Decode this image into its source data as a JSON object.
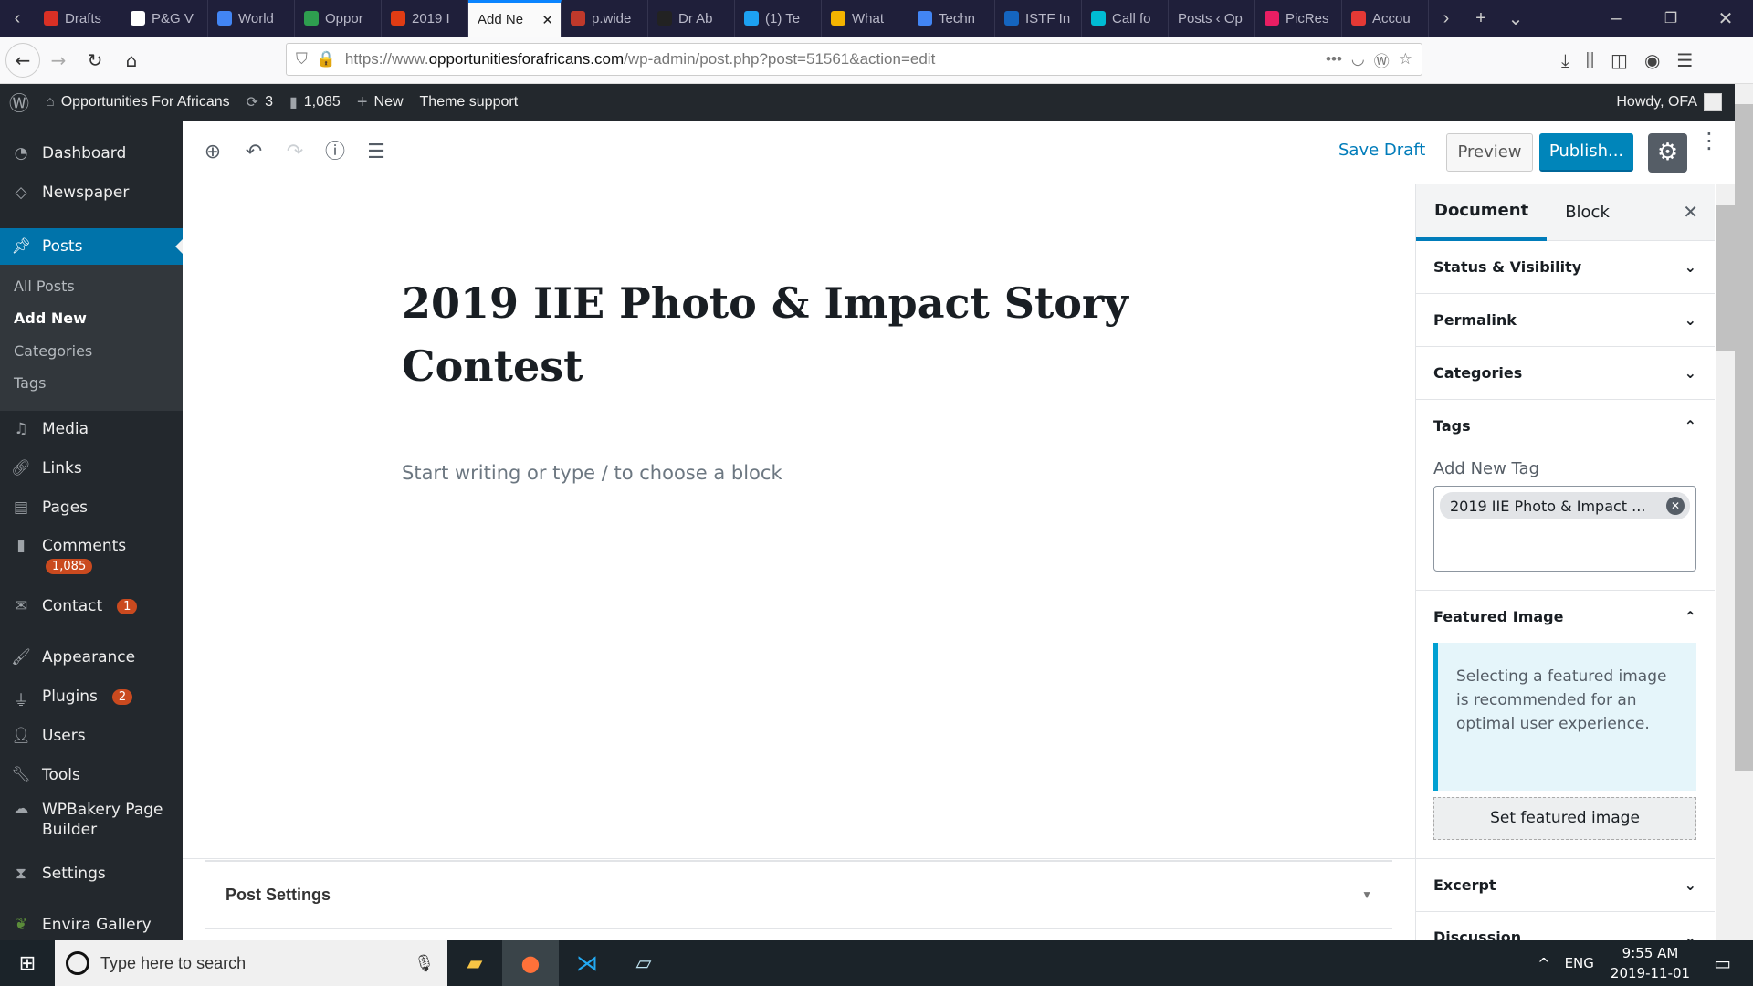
{
  "browser": {
    "tabs": [
      {
        "label": "Drafts",
        "color": "#d93025"
      },
      {
        "label": "P&G V",
        "color": "#ffffff"
      },
      {
        "label": "World",
        "color": "#4285f4"
      },
      {
        "label": "Oppor",
        "color": "#2e9e4f"
      },
      {
        "label": "2019 I",
        "color": "#e03c14"
      },
      {
        "label": "Add Ne",
        "color": "",
        "active": true
      },
      {
        "label": "p.wide",
        "color": "#c0392b"
      },
      {
        "label": "Dr Ab",
        "color": "#222222"
      },
      {
        "label": "(1) Te",
        "color": "#1da1f2"
      },
      {
        "label": "What",
        "color": "#f4b400"
      },
      {
        "label": "Techn",
        "color": "#4285f4"
      },
      {
        "label": "ISTF In",
        "color": "#1565c0"
      },
      {
        "label": "Call fo",
        "color": "#00bcd4"
      },
      {
        "label": "Posts ‹ Op",
        "color": ""
      },
      {
        "label": "PicRes",
        "color": "#e91e63"
      },
      {
        "label": "Accou",
        "color": "#e53935"
      }
    ],
    "url_prefix": "https://www.",
    "url_domain": "opportunitiesforafricans.com",
    "url_suffix": "/wp-admin/post.php?post=51561&action=edit"
  },
  "adminbar": {
    "site": "Opportunities For Africans",
    "updates": "3",
    "comments": "1,085",
    "new": "New",
    "theme_support": "Theme support",
    "howdy": "Howdy, OFA"
  },
  "sidebar": {
    "items": [
      "Dashboard",
      "Newspaper",
      "Posts",
      "Media",
      "Links",
      "Pages",
      "Comments",
      "Contact",
      "Appearance",
      "Plugins",
      "Users",
      "Tools",
      "WPBakery Page Builder",
      "Settings",
      "Envira Gallery"
    ],
    "sub": [
      "All Posts",
      "Add New",
      "Categories",
      "Tags"
    ],
    "comments_badge": "1,085",
    "contact_badge": "1",
    "plugins_badge": "2"
  },
  "editor": {
    "save_draft": "Save Draft",
    "preview": "Preview",
    "publish": "Publish...",
    "title": "2019 IIE Photo & Impact Story Contest",
    "placeholder": "Start writing or type / to choose a block",
    "post_settings": "Post Settings"
  },
  "panel": {
    "tab_document": "Document",
    "tab_block": "Block",
    "sections": [
      "Status & Visibility",
      "Permalink",
      "Categories",
      "Tags",
      "Featured Image",
      "Excerpt",
      "Discussion"
    ],
    "add_tag_label": "Add New Tag",
    "tag": "2019 IIE Photo & Impact ...",
    "featured_notice": "Selecting a featured image is recommended for an optimal user experience.",
    "set_featured": "Set featured image"
  },
  "taskbar": {
    "search": "Type here to search",
    "lang": "ENG",
    "time": "9:55 AM",
    "date": "2019-11-01"
  },
  "colors": {
    "accent": "#007cba",
    "admin_bar": "#23282d",
    "badge": "#ca4a1f"
  }
}
